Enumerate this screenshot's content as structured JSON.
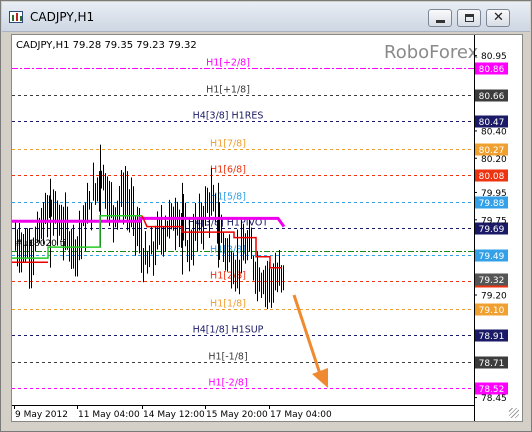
{
  "window": {
    "title": "CADJPY,H1"
  },
  "chart": {
    "symbol_line": "CADJPY,H1  79.28 79.35 79.23 79.32",
    "watermark": "RoboForex",
    "time_labels": [
      "9 May 2012",
      "11 May 04:00",
      "14 May 12:00",
      "15 May 20:00",
      "17 May 04:00"
    ],
    "overlay_fragment": "#µ£8020 ti",
    "levels": [
      {
        "label": "H1[+2/8]",
        "price": 80.86,
        "price_label": "80.86",
        "color": "#ff00ff",
        "box": true,
        "dash": "dashdot"
      },
      {
        "label": "H1[+1/8]",
        "price": 80.66,
        "price_label": "80.66",
        "color": "#3c3c3c",
        "box": true,
        "dash": "dash"
      },
      {
        "label": "H4[3/8] H1RES",
        "price": 80.47,
        "price_label": "80.47",
        "color": "#1a1a66",
        "box": true,
        "dash": "dash"
      },
      {
        "label": "H1[7/8]",
        "price": 80.27,
        "price_label": "80.27",
        "color": "#f0a030",
        "box": true,
        "dash": "dash"
      },
      {
        "label": "H1[6/8]",
        "price": 80.08,
        "price_label": "80.08",
        "color": "#ee3311",
        "box": true,
        "dash": "dash"
      },
      {
        "label": "H1[5/8]",
        "price": 79.88,
        "price_label": "79.88",
        "color": "#33a0e8",
        "box": true,
        "dash": "dash"
      },
      {
        "label": "H4[3/8] H1PIVOT",
        "price": 79.69,
        "price_label": "79.69",
        "color": "#1a1a66",
        "box": true,
        "dash": "dash"
      },
      {
        "label": "H1[3/8]",
        "price": 79.49,
        "price_label": "79.49",
        "color": "#33a0e8",
        "box": true,
        "dash": "dash"
      },
      {
        "label": "H1[2/8]",
        "price": 79.3,
        "price_label": "79.30",
        "color": "#ee3311",
        "box": true,
        "dash": "dash"
      },
      {
        "label": "H1[1/8]",
        "price": 79.1,
        "price_label": "79.10",
        "color": "#f0a030",
        "box": true,
        "dash": "dash"
      },
      {
        "label": "H4[1/8] H1SUP",
        "price": 78.91,
        "price_label": "78.91",
        "color": "#1a1a66",
        "box": true,
        "dash": "dash"
      },
      {
        "label": "H1[-1/8]",
        "price": 78.71,
        "price_label": "78.71",
        "color": "#3c3c3c",
        "box": true,
        "dash": "dash"
      },
      {
        "label": "H1[-2/8]",
        "price": 78.52,
        "price_label": "78.52",
        "color": "#ff00ff",
        "box": true,
        "dash": "dash"
      }
    ],
    "axis_prices": [
      {
        "price": 80.95,
        "label": "80.95"
      },
      {
        "price": 80.4,
        "label": "80.40"
      },
      {
        "price": 80.2,
        "label": "80.20"
      },
      {
        "price": 79.95,
        "label": "79.95"
      },
      {
        "price": 79.75,
        "label": "79.75"
      },
      {
        "price": 79.2,
        "label": "79.20"
      },
      {
        "price": 78.45,
        "label": "78.45"
      }
    ],
    "current_price": {
      "price": 79.32,
      "label": "79.32",
      "color": "#555555"
    },
    "colors": {
      "magenta_line": "#ee00ee",
      "red_stop": "#ee0000",
      "green_stop": "#22cc22",
      "arrow": "#f08a30",
      "bars": "#000000",
      "green_level": "#1a8a1a"
    }
  }
}
